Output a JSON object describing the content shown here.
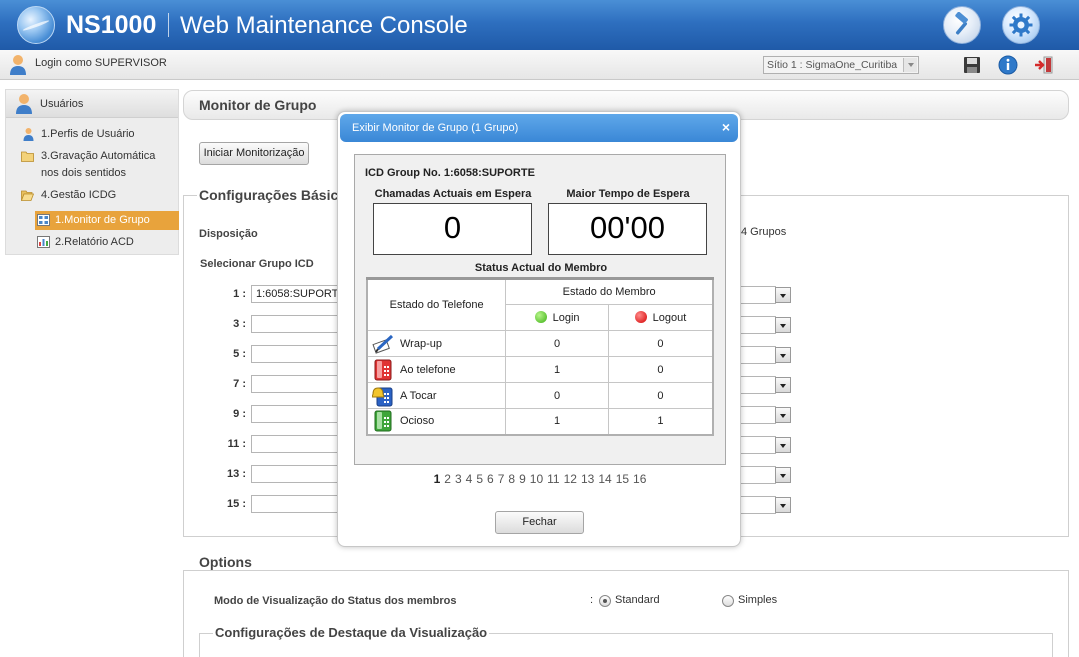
{
  "header": {
    "brand": "NS1000",
    "subtitle": "Web Maintenance Console"
  },
  "subbar": {
    "login": "Login como SUPERVISOR",
    "site": "Sítio 1 : SigmaOne_Curitiba"
  },
  "sidebar": {
    "heading": "Usuários",
    "items": [
      {
        "label": "1.Perfis de Usuário"
      },
      {
        "label": "3.Gravação Automática"
      },
      {
        "label": "nos dois sentidos"
      },
      {
        "label": "4.Gestão ICDG"
      },
      {
        "label": "1.Monitor de Grupo"
      },
      {
        "label": "2.Relatório ACD"
      }
    ]
  },
  "main": {
    "title": "Monitor de Grupo",
    "start_button": "Iniciar Monitorização",
    "basic_config_legend": "Configurações Básica",
    "disposition_label": "Disposição",
    "groups_text": "4 Grupos",
    "select_group_label": "Selecionar Grupo ICD",
    "rows": [
      {
        "num": "1 :",
        "value": "1:6058:SUPORTE"
      },
      {
        "num": "3 :",
        "value": ""
      },
      {
        "num": "5 :",
        "value": ""
      },
      {
        "num": "7 :",
        "value": ""
      },
      {
        "num": "9 :",
        "value": ""
      },
      {
        "num": "11 :",
        "value": ""
      },
      {
        "num": "13 :",
        "value": ""
      },
      {
        "num": "15 :",
        "value": ""
      }
    ],
    "options_legend": "Options",
    "view_mode_label": "Modo de Visualização do Status dos membros",
    "colon": ":",
    "standard": "Standard",
    "simple": "Simples",
    "highlight_legend": "Configurações de Destaque da Visualização"
  },
  "modal": {
    "title": "Exibir Monitor de Grupo (1 Grupo)",
    "close_x": "×",
    "icd_group": "ICD Group No. 1:6058:SUPORTE",
    "waiting_calls_label": "Chamadas Actuais em Espera",
    "waiting_calls_value": "0",
    "max_wait_label": "Maior Tempo de Espera",
    "max_wait_value": "00'00",
    "member_status_title": "Status Actual do Membro",
    "phone_status_header": "Estado do Telefone",
    "member_state_header": "Estado do Membro",
    "login_header": "Login",
    "logout_header": "Logout",
    "status_rows": [
      {
        "label": "Wrap-up",
        "login": "0",
        "logout": "0",
        "icon": "wrapup-icon"
      },
      {
        "label": "Ao telefone",
        "login": "1",
        "logout": "0",
        "icon": "phone-busy-icon"
      },
      {
        "label": "A Tocar",
        "login": "0",
        "logout": "0",
        "icon": "phone-ringing-icon"
      },
      {
        "label": "Ocioso",
        "login": "1",
        "logout": "1",
        "icon": "phone-idle-icon"
      }
    ],
    "pages": [
      "1",
      "2",
      "3",
      "4",
      "5",
      "6",
      "7",
      "8",
      "9",
      "10",
      "11",
      "12",
      "13",
      "14",
      "15",
      "16"
    ],
    "current_page": "1",
    "close_button": "Fechar"
  },
  "colors": {
    "header_blue": "#2e6fbf",
    "modal_title_blue": "#4a95df",
    "sidebar_active": "#e8a33c"
  }
}
